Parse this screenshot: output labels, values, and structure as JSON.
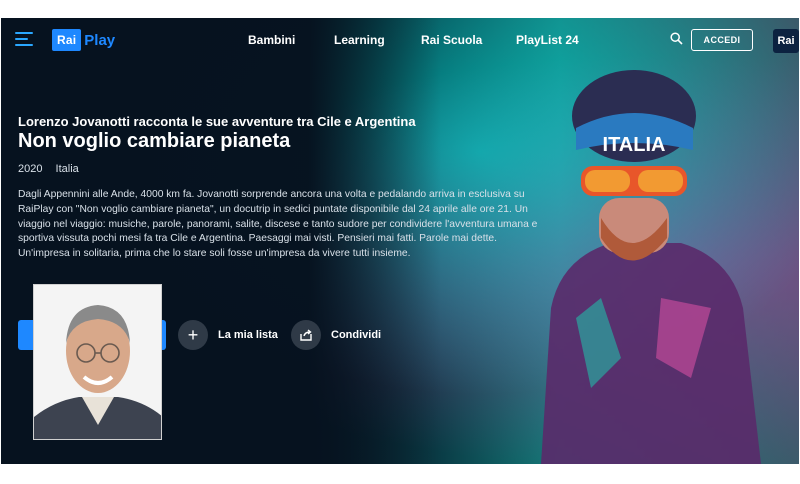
{
  "header": {
    "logo_box": "Rai",
    "logo_word": "Play",
    "nav": [
      "Bambini",
      "Learning",
      "Rai Scuola",
      "PlayList 24"
    ],
    "login_label": "ACCEDI",
    "rai_badge": "Rai"
  },
  "show": {
    "subtitle": "Lorenzo Jovanotti racconta le sue avventure tra Cile e Argentina",
    "title": "Non voglio cambiare pianeta",
    "year": "2020",
    "country": "Italia",
    "description": "Dagli Appennini alle Ande, 4000 km fa. Jovanotti sorprende ancora una volta e pedalando arriva in esclusiva su RaiPlay con \"Non voglio cambiare pianeta\", un docutrip in sedici puntate disponibile dal 24 aprile alle ore 21. Un viaggio nel viaggio: musiche, parole, panorami, salite, discese e tanto sudore per condividere l'avventura umana e sportiva vissuta pochi mesi fa tra Cile e Argentina. Paesaggi mai visti. Pensieri mai fatti. Parole mai dette. Un'impresa in solitaria, prima che lo stare soli fosse un'impresa da vivere tutti insieme."
  },
  "actions": {
    "my_list_label": "La mia lista",
    "share_label": "Condividi"
  },
  "hero_image": {
    "helmet_text": "ITALIA"
  },
  "colors": {
    "brand_blue": "#1e88ff",
    "background": "#06121f"
  }
}
